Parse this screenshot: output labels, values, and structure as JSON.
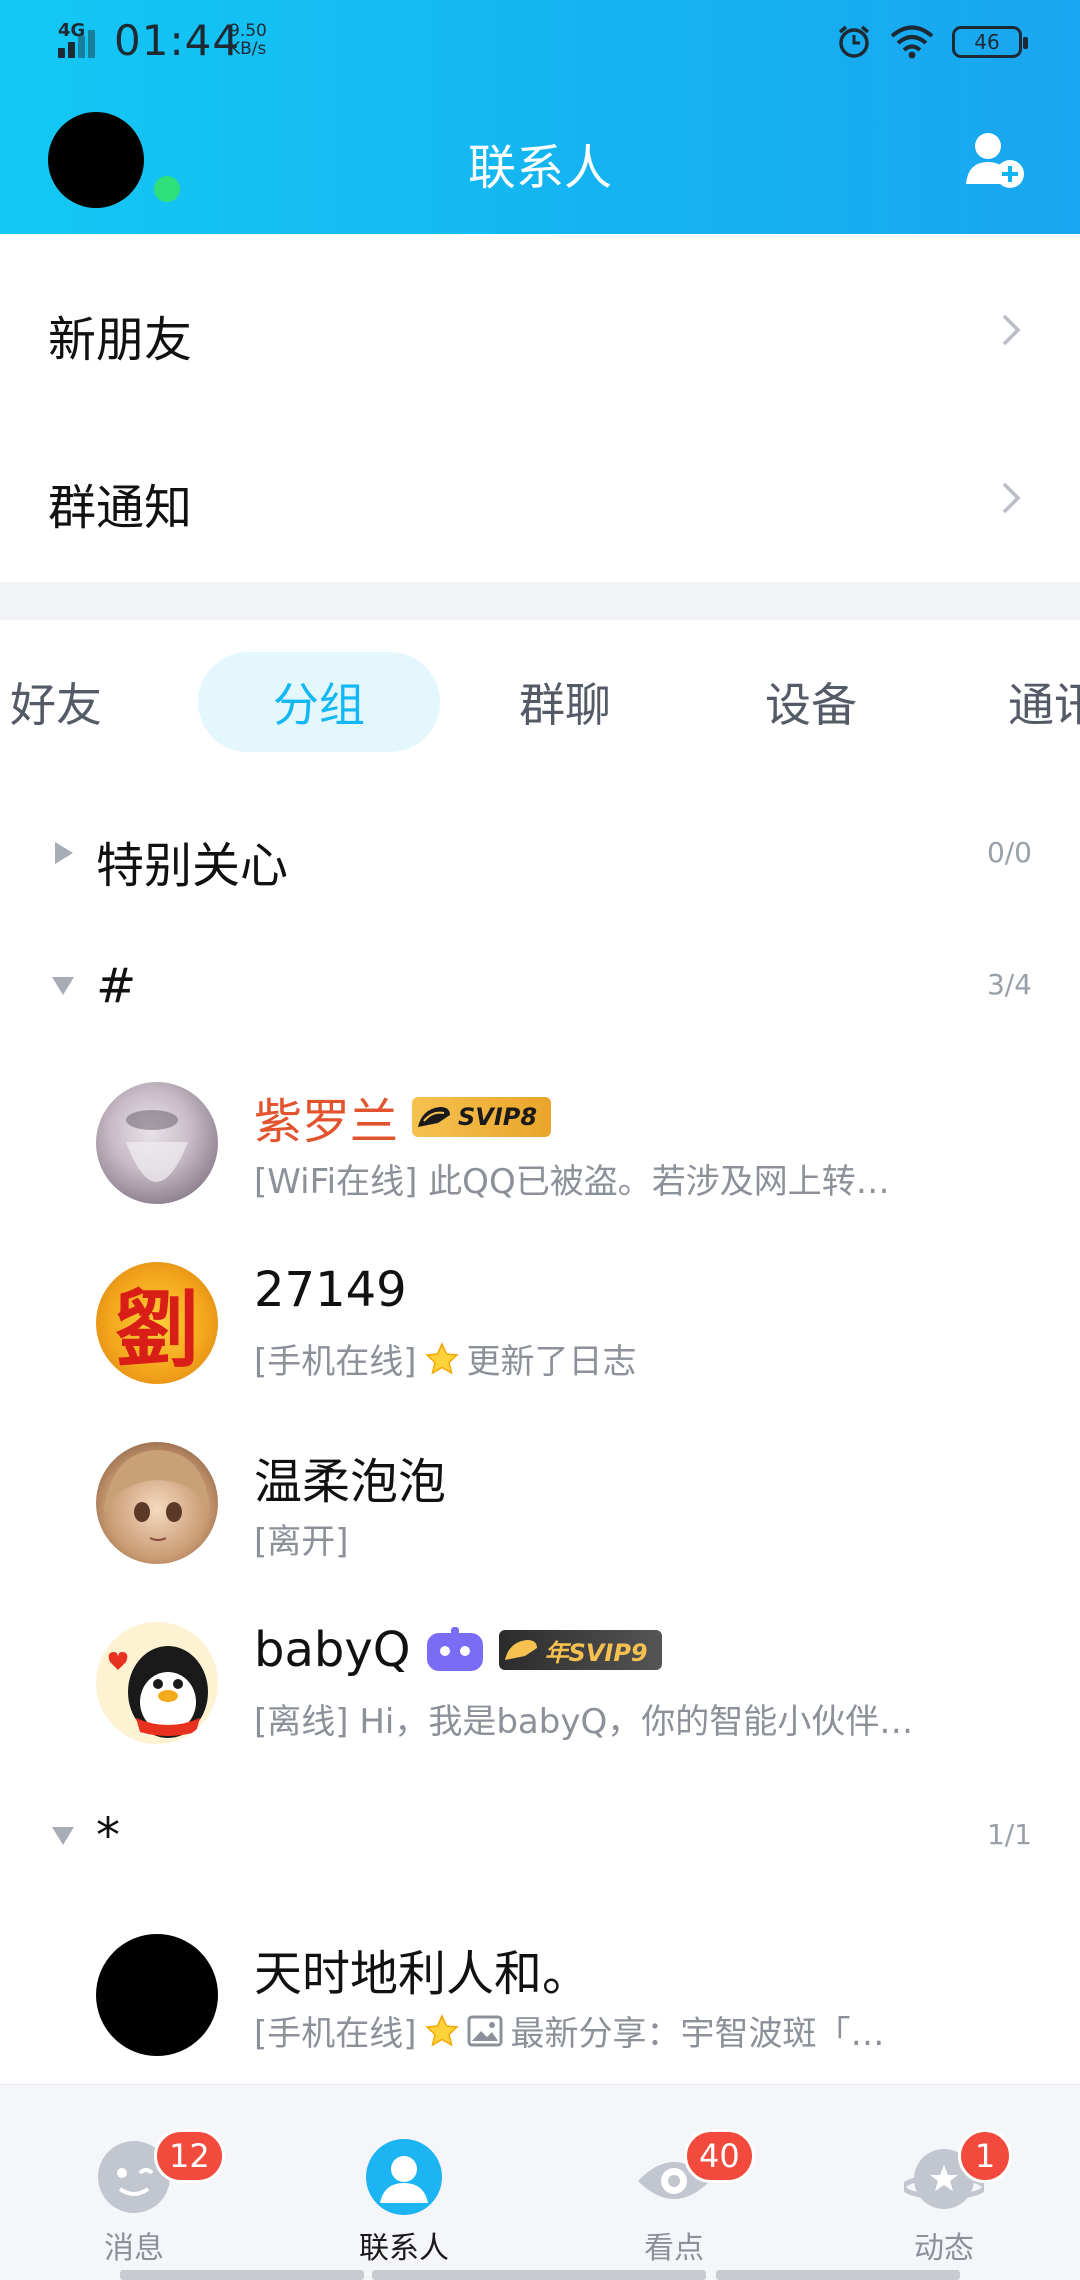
{
  "status_bar": {
    "network": "4G",
    "time": "01:44",
    "speed_value": "9.50",
    "speed_unit": "KB/s",
    "battery": "46",
    "icons": [
      "alarm-icon",
      "wifi-icon",
      "battery-icon"
    ]
  },
  "header": {
    "title": "联系人",
    "avatar_icon": "user-avatar",
    "online_status": "online",
    "add_icon": "add-contact-icon"
  },
  "entries": [
    {
      "label": "新朋友"
    },
    {
      "label": "群通知"
    }
  ],
  "tabs": [
    {
      "label": "好友"
    },
    {
      "label": "分组",
      "active": true
    },
    {
      "label": "群聊"
    },
    {
      "label": "设备"
    },
    {
      "label": "通讯"
    }
  ],
  "groups": [
    {
      "name": "特别关心",
      "count": "0/0",
      "expanded": false
    },
    {
      "name": "#",
      "count": "3/4",
      "expanded": true
    },
    {
      "name": "*",
      "count": "1/1",
      "expanded": true
    }
  ],
  "contacts": [
    {
      "name": "紫罗兰",
      "badge": "SVIP8",
      "status": "[WiFi在线] 此QQ已被盗。若涉及网上转…",
      "vip": true
    },
    {
      "name": "27149",
      "status_prefix": "[手机在线]",
      "status": "更新了日志"
    },
    {
      "name": "温柔泡泡",
      "status": "[离开]"
    },
    {
      "name": "babyQ",
      "badge": "年SVIP9",
      "status": "[离线] Hi，我是babyQ，你的智能小伙伴…"
    },
    {
      "name": "天时地利人和。",
      "status_prefix": "[手机在线]",
      "status": "最新分享：宇智波斑「…"
    }
  ],
  "avatars": {
    "avatar_27149_char": "劉"
  },
  "bottom_nav": [
    {
      "label": "消息",
      "badge": "12",
      "icon": "message-icon"
    },
    {
      "label": "联系人",
      "active": true,
      "icon": "contacts-icon"
    },
    {
      "label": "看点",
      "badge": "40",
      "icon": "watch-icon"
    },
    {
      "label": "动态",
      "badge": "1",
      "icon": "moments-icon"
    }
  ],
  "colors": {
    "header_start": "#14c8f4",
    "header_end": "#1aa6f0",
    "accent": "#12b7f5",
    "vip_name": "#e2542e",
    "badge_red": "#f24a3c"
  }
}
